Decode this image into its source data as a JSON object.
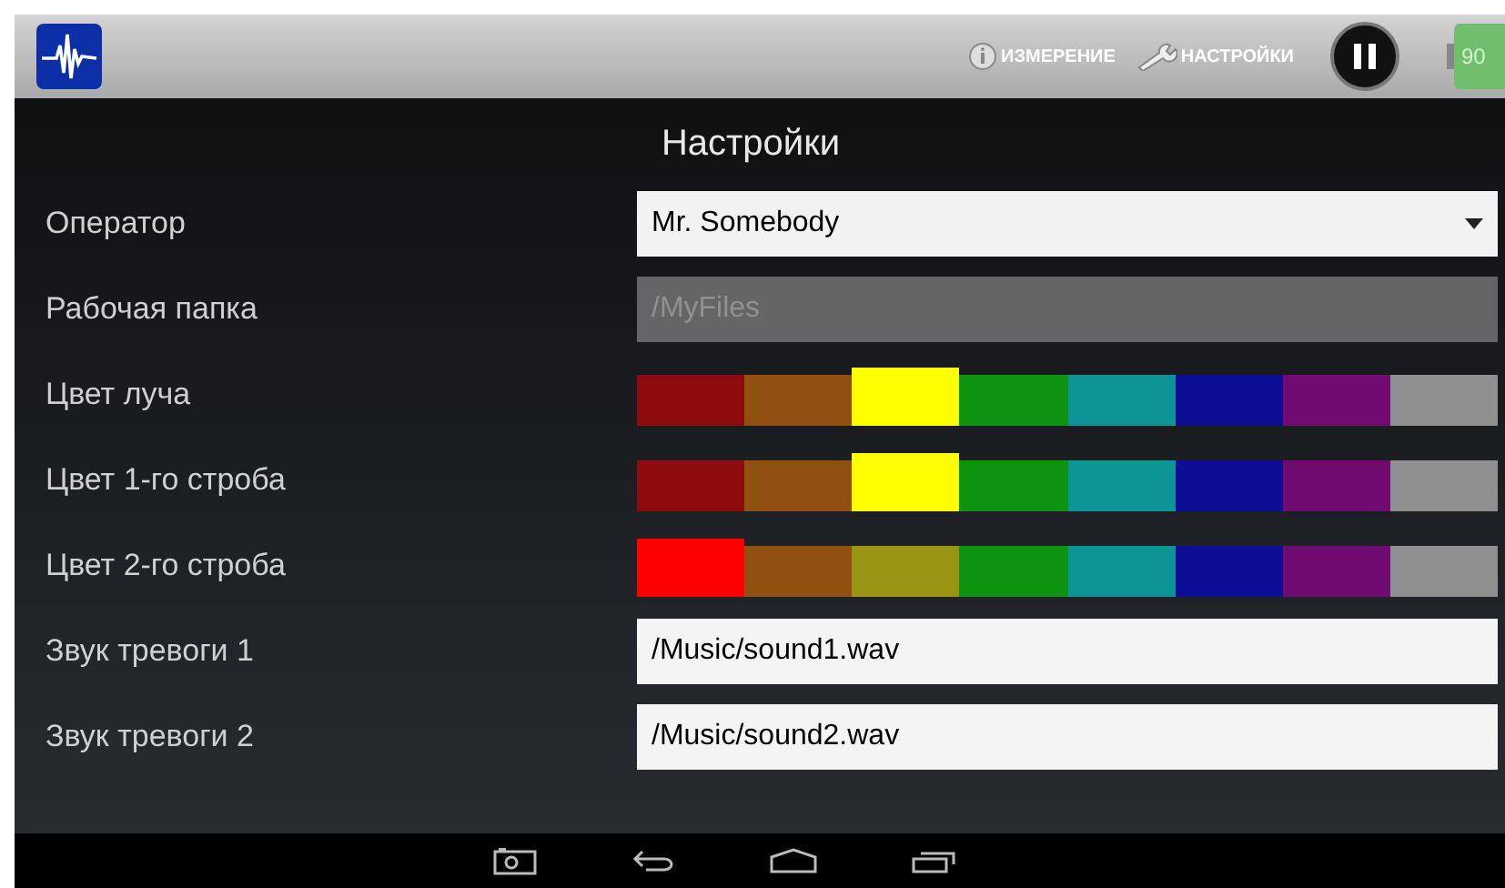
{
  "top_bar": {
    "menu_items": [
      {
        "label": "ИЗМЕРЕНИЕ",
        "kind": "info"
      },
      {
        "label": "НАСТРОЙКИ",
        "kind": "wrench"
      }
    ],
    "paused": true,
    "battery": "90"
  },
  "title": "Настройки",
  "settings": [
    {
      "label": "Оператор",
      "kind": "dropdown",
      "value": "Mr. Somebody"
    },
    {
      "label": "Рабочая папка",
      "kind": "text",
      "value": "/MyFiles",
      "disabled": true
    },
    {
      "label": "Цвет луча",
      "kind": "colors",
      "swatches": [
        {
          "color": "#8e0b0d",
          "selected": false
        },
        {
          "color": "#91500f",
          "selected": false
        },
        {
          "color": "#ffff00",
          "selected": true
        },
        {
          "color": "#0d930f",
          "selected": false
        },
        {
          "color": "#0d9496",
          "selected": false
        },
        {
          "color": "#0d0d96",
          "selected": false
        },
        {
          "color": "#700b72",
          "selected": false
        },
        {
          "color": "#909090",
          "selected": false
        }
      ]
    },
    {
      "label": "Цвет 1-го строба",
      "kind": "colors",
      "swatches": [
        {
          "color": "#8e0b0d",
          "selected": false
        },
        {
          "color": "#91500f",
          "selected": false
        },
        {
          "color": "#ffff00",
          "selected": true
        },
        {
          "color": "#0d930f",
          "selected": false
        },
        {
          "color": "#0d9496",
          "selected": false
        },
        {
          "color": "#0d0d96",
          "selected": false
        },
        {
          "color": "#700b72",
          "selected": false
        },
        {
          "color": "#909090",
          "selected": false
        }
      ]
    },
    {
      "label": "Цвет 2-го строба",
      "kind": "colors",
      "swatches": [
        {
          "color": "#ff0000",
          "selected": true
        },
        {
          "color": "#91500f",
          "selected": false
        },
        {
          "color": "#999414",
          "selected": false
        },
        {
          "color": "#0d930f",
          "selected": false
        },
        {
          "color": "#0d9496",
          "selected": false
        },
        {
          "color": "#0d0d96",
          "selected": false
        },
        {
          "color": "#700b72",
          "selected": false
        },
        {
          "color": "#909090",
          "selected": false
        }
      ]
    },
    {
      "label": "Звук тревоги 1",
      "kind": "text",
      "value": "/Music/sound1.wav",
      "disabled": false
    },
    {
      "label": "Звук тревоги 2",
      "kind": "text",
      "value": "/Music/sound2.wav",
      "disabled": false
    }
  ]
}
